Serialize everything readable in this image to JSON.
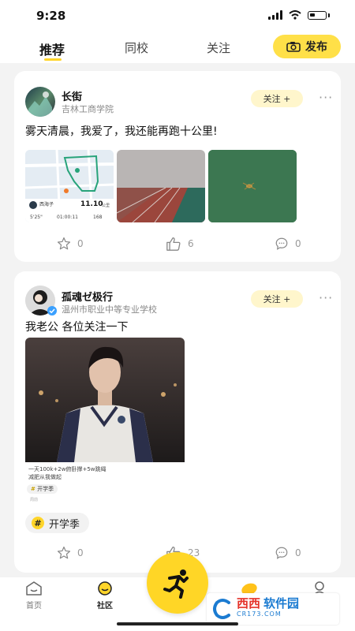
{
  "status_bar": {
    "time": "9:28"
  },
  "top_tabs": {
    "tabs": [
      {
        "label": "推荐",
        "active": true
      },
      {
        "label": "同校",
        "active": false
      },
      {
        "label": "关注",
        "active": false
      }
    ],
    "publish_label": "发布"
  },
  "posts": [
    {
      "user": "长街",
      "school": "吉林工商学院",
      "follow_label": "关注 +",
      "text": "雾天清晨，我爱了，我还能再跑十公里!",
      "map": {
        "place": "西海子",
        "distance": "11.10",
        "unit": "公里",
        "pace": "5'25\"",
        "duration": "01:00:11",
        "steps": "168"
      },
      "likes": {
        "star": "0",
        "thumb": "6",
        "comment": "0"
      }
    },
    {
      "user": "孤魂ゼ极行",
      "school": "温州市职业中等专业学校",
      "follow_label": "关注 +",
      "text": "我老公 各位关注一下",
      "caption": "一天100k+2w俯卧撑+5w跳绳\n减肥从我做起",
      "mini_tag": "开学季",
      "mini_foot": "周前",
      "tag": "开学季",
      "likes": {
        "star": "0",
        "thumb": "23",
        "comment": "0"
      }
    }
  ],
  "bottom_nav": {
    "items": [
      {
        "label": "首页"
      },
      {
        "label": "社区",
        "active": true
      },
      {
        "label": ""
      },
      {
        "label": ""
      }
    ]
  },
  "watermark": {
    "brand": "西西",
    "sub": "软件园",
    "url": "CR173.COM"
  }
}
